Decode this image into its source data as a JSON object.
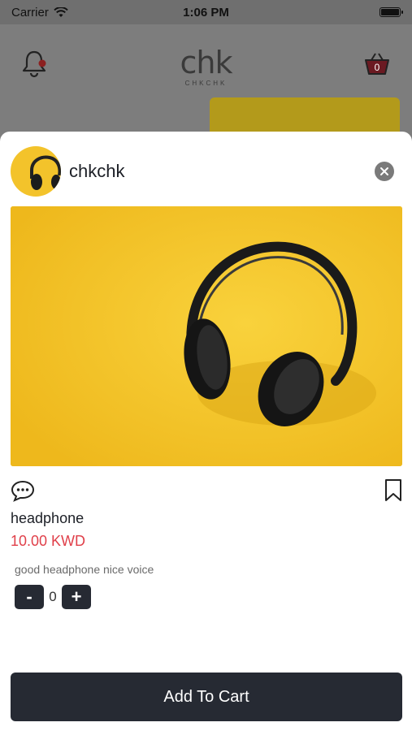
{
  "status_bar": {
    "carrier": "Carrier",
    "time": "1:06 PM"
  },
  "header": {
    "logo_main": "chk",
    "logo_sub": "CHKCHK",
    "cart_count": "0",
    "notification_color": "#d63030",
    "cart_color": "#a01d2a"
  },
  "modal": {
    "shop_name": "chkchk",
    "product": {
      "name": "headphone",
      "price": "10.00 KWD",
      "description": "good headphone nice voice",
      "quantity": "0"
    },
    "qty_minus_label": "-",
    "qty_plus_label": "+",
    "add_to_cart_label": "Add To Cart"
  },
  "icons": {
    "bell": "bell-icon",
    "cart": "shopping-basket-icon",
    "close": "close-icon",
    "comment": "comment-icon",
    "bookmark": "bookmark-icon"
  },
  "colors": {
    "primary_dark": "#262a33",
    "price_red": "#e0404a",
    "image_yellow": "#f5c42c"
  }
}
